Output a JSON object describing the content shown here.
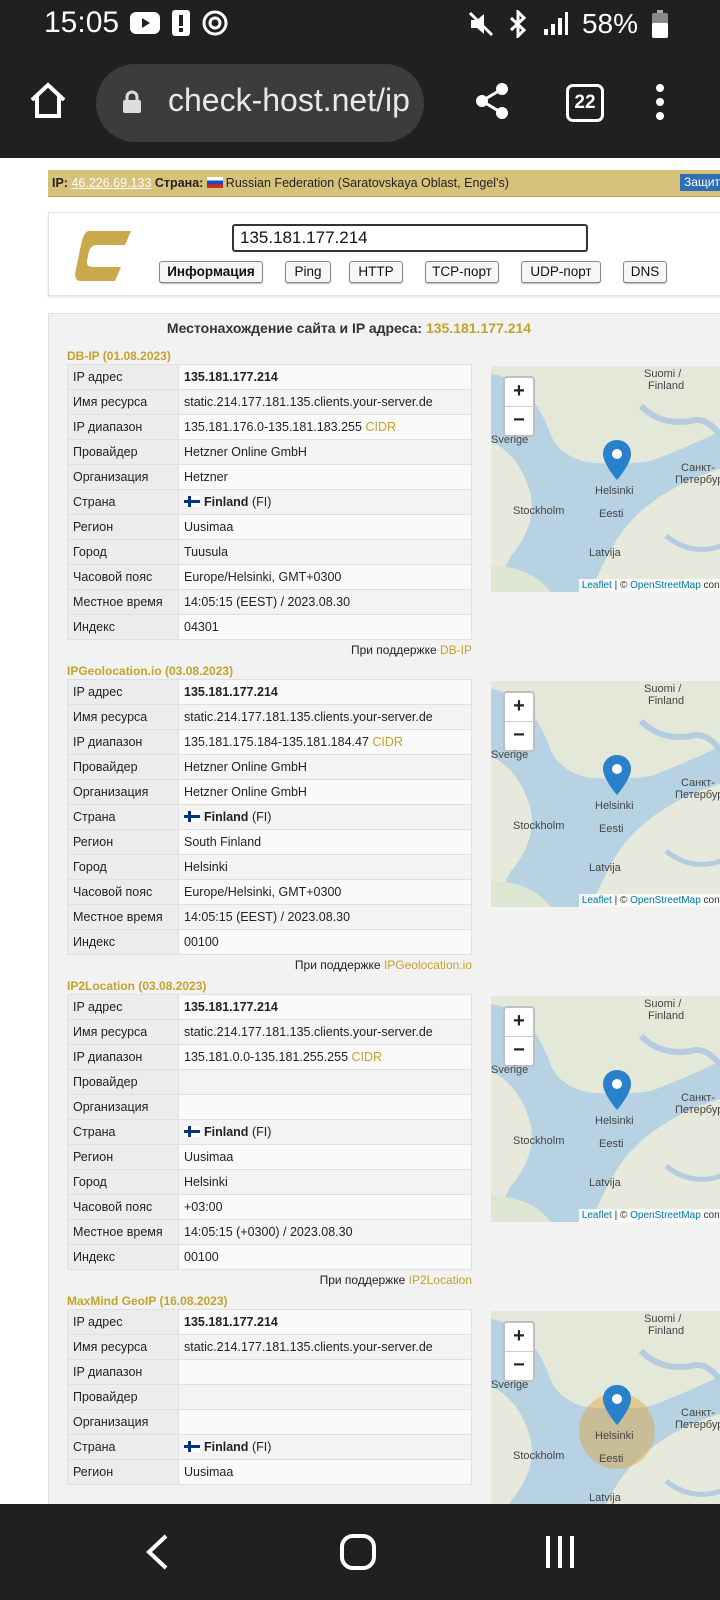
{
  "status_bar": {
    "time": "15:05",
    "battery": "58%"
  },
  "browser": {
    "url": "check-host.net/ip",
    "tab_count": "22"
  },
  "ip_banner": {
    "ip_label": "IP:",
    "ip_value": "46.226.69.133",
    "country_label": "Страна:",
    "country_value": "Russian Federation (Saratovskaya Oblast, Engel's)",
    "protect_label": "Защит"
  },
  "search": {
    "value": "135.181.177.214",
    "buttons": [
      "Информация",
      "Ping",
      "HTTP",
      "TCP-порт",
      "UDP-порт",
      "DNS"
    ]
  },
  "content": {
    "title_prefix": "Местонахождение сайта и IP адреса:",
    "title_ip": "135.181.177.214"
  },
  "labels": {
    "ip": "IP адрес",
    "host": "Имя ресурса",
    "range": "IP диапазон",
    "provider": "Провайдер",
    "org": "Организация",
    "country": "Страна",
    "region": "Регион",
    "city": "Город",
    "timezone": "Часовой пояс",
    "localtime": "Местное время",
    "postal": "Индекс",
    "cidr": "CIDR",
    "support": "При поддержке"
  },
  "map": {
    "zoom_in": "+",
    "zoom_out": "−",
    "attribution_leaflet": "Leaflet",
    "attribution_sep": " | © ",
    "attribution_osm": "OpenStreetMap",
    "attribution_rest": " contri",
    "place_labels": {
      "suomi": "Suomi /",
      "finland": "Finland",
      "sverige": "Sverige",
      "sankt": "Санкт-",
      "peterburg": "Петербург",
      "helsinki": "Helsinki",
      "stockholm": "Stockholm",
      "eesti": "Eesti",
      "latvija": "Latvija"
    }
  },
  "sources": [
    {
      "title": "DB-IP (01.08.2023)",
      "ip": "135.181.177.214",
      "host": "static.214.177.181.135.clients.your-server.de",
      "range": "135.181.176.0-135.181.183.255",
      "provider": "Hetzner Online GmbH",
      "org": "Hetzner",
      "country": "Finland",
      "country_code": "(FI)",
      "region": "Uusimaa",
      "city": "Tuusula",
      "timezone": "Europe/Helsinki, GMT+0300",
      "localtime": "14:05:15 (EEST) / 2023.08.30",
      "postal": "04301",
      "support_link": "DB-IP"
    },
    {
      "title": "IPGeolocation.io (03.08.2023)",
      "ip": "135.181.177.214",
      "host": "static.214.177.181.135.clients.your-server.de",
      "range": "135.181.175.184-135.181.184.47",
      "provider": "Hetzner Online GmbH",
      "org": "Hetzner Online GmbH",
      "country": "Finland",
      "country_code": "(FI)",
      "region": "South Finland",
      "city": "Helsinki",
      "timezone": "Europe/Helsinki, GMT+0300",
      "localtime": "14:05:15 (EEST) / 2023.08.30",
      "postal": "00100",
      "support_link": "IPGeolocation.io"
    },
    {
      "title": "IP2Location (03.08.2023)",
      "ip": "135.181.177.214",
      "host": "static.214.177.181.135.clients.your-server.de",
      "range": "135.181.0.0-135.181.255.255",
      "provider": "",
      "org": "",
      "country": "Finland",
      "country_code": "(FI)",
      "region": "Uusimaa",
      "city": "Helsinki",
      "timezone": "+03:00",
      "localtime": "14:05:15 (+0300) / 2023.08.30",
      "postal": "00100",
      "support_link": "IP2Location"
    },
    {
      "title": "MaxMind GeoIP (16.08.2023)",
      "ip": "135.181.177.214",
      "host": "static.214.177.181.135.clients.your-server.de",
      "range": "",
      "provider": "",
      "org": "",
      "country": "Finland",
      "country_code": "(FI)",
      "region": "Uusimaa"
    }
  ]
}
